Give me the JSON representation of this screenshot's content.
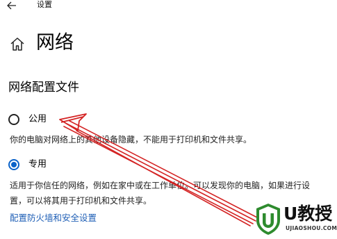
{
  "window": {
    "title": "设置"
  },
  "page": {
    "title": "网络"
  },
  "section": {
    "title": "网络配置文件"
  },
  "profiles": {
    "public": {
      "label": "公用",
      "description": "你的电脑对网络上的其他设备隐藏，不能用于打印机和文件共享。",
      "selected": false
    },
    "private": {
      "label": "专用",
      "description": "适用于你信任的网络，例如在家中或在工作单位。可以发现你的电脑，如果进行设置，可以将其用于打印机和文件共享。",
      "selected": true
    }
  },
  "links": {
    "firewall": "配置防火墙和安全设置"
  },
  "watermark": {
    "brand": "U教授",
    "url": "UJIAOSHOU.COM"
  },
  "colors": {
    "accent": "#0b63c9",
    "link": "#1f5fb6",
    "annotation_arrow": "#d42424",
    "watermark_green": "#2e8b2e"
  },
  "icons": {
    "back": "back-arrow-icon",
    "home": "home-icon"
  }
}
